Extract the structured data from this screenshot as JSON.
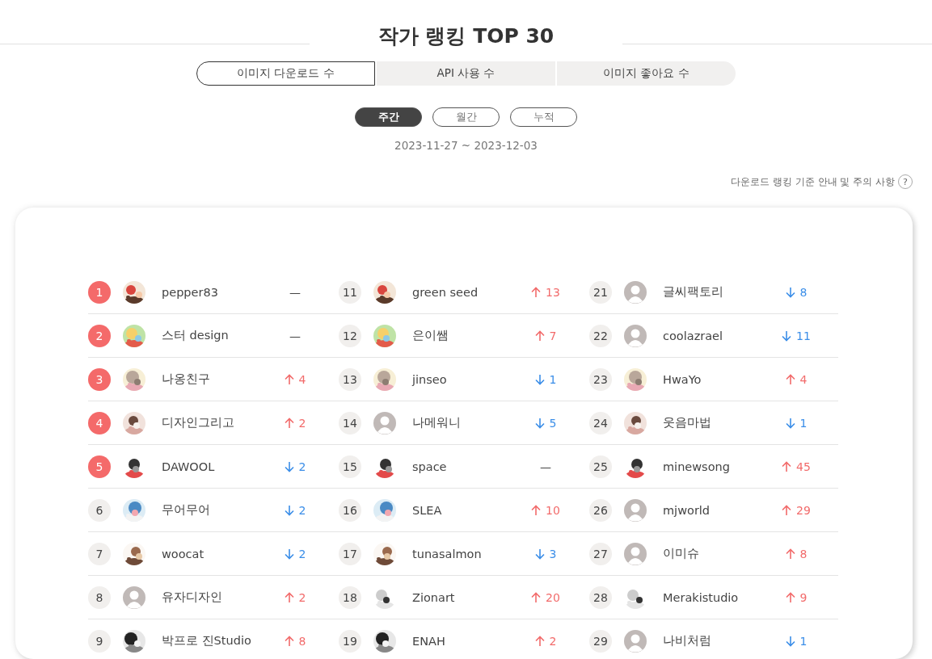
{
  "title": "작가 랭킹 TOP 30",
  "metric_tabs": [
    {
      "label": "이미지 다운로드 수",
      "selected": true
    },
    {
      "label": "API 사용 수",
      "selected": false
    },
    {
      "label": "이미지 좋아요 수",
      "selected": false
    }
  ],
  "period_tabs": [
    {
      "label": "주간",
      "selected": true
    },
    {
      "label": "월간",
      "selected": false
    },
    {
      "label": "누적",
      "selected": false
    }
  ],
  "date_range": "2023-11-27 ~ 2023-12-03",
  "help_link": {
    "label": "다운로드 랭킹 기준 안내 및 주의 사항",
    "icon": "?"
  },
  "columns": [
    {
      "entries": [
        {
          "rank": "1",
          "top": true,
          "name": "pepper83",
          "trend": {
            "kind": "same",
            "amount": "—"
          }
        },
        {
          "rank": "2",
          "top": true,
          "name": "스터 design",
          "trend": {
            "kind": "same",
            "amount": "—"
          }
        },
        {
          "rank": "3",
          "top": true,
          "name": "나옹친구",
          "trend": {
            "kind": "up",
            "amount": "4"
          }
        },
        {
          "rank": "4",
          "top": true,
          "name": "디자인그리고",
          "trend": {
            "kind": "up",
            "amount": "2"
          }
        },
        {
          "rank": "5",
          "top": true,
          "name": "DAWOOL",
          "trend": {
            "kind": "down",
            "amount": "2"
          }
        },
        {
          "rank": "6",
          "top": false,
          "name": "무어무어",
          "trend": {
            "kind": "down",
            "amount": "2"
          }
        },
        {
          "rank": "7",
          "top": false,
          "name": "woocat",
          "trend": {
            "kind": "down",
            "amount": "2"
          }
        },
        {
          "rank": "8",
          "top": false,
          "name": "유자디자인",
          "avatar": {
            "kind": "default"
          },
          "trend": {
            "kind": "up",
            "amount": "2"
          }
        },
        {
          "rank": "9",
          "top": false,
          "name": "박프로 진Studio",
          "trend": {
            "kind": "up",
            "amount": "8"
          }
        }
      ]
    },
    {
      "entries": [
        {
          "rank": "11",
          "top": false,
          "name": "green seed",
          "trend": {
            "kind": "up",
            "amount": "13"
          }
        },
        {
          "rank": "12",
          "top": false,
          "name": "은이쌤",
          "trend": {
            "kind": "up",
            "amount": "7"
          }
        },
        {
          "rank": "13",
          "top": false,
          "name": "jinseo",
          "trend": {
            "kind": "down",
            "amount": "1"
          }
        },
        {
          "rank": "14",
          "top": false,
          "name": "나메워니",
          "avatar": {
            "kind": "default"
          },
          "trend": {
            "kind": "down",
            "amount": "5"
          }
        },
        {
          "rank": "15",
          "top": false,
          "name": "space",
          "trend": {
            "kind": "same",
            "amount": "—"
          }
        },
        {
          "rank": "16",
          "top": false,
          "name": "SLEA",
          "trend": {
            "kind": "up",
            "amount": "10"
          }
        },
        {
          "rank": "17",
          "top": false,
          "name": "tunasalmon",
          "trend": {
            "kind": "down",
            "amount": "3"
          }
        },
        {
          "rank": "18",
          "top": false,
          "name": "Zionart",
          "trend": {
            "kind": "up",
            "amount": "20"
          }
        },
        {
          "rank": "19",
          "top": false,
          "name": "ENAH",
          "trend": {
            "kind": "up",
            "amount": "2"
          }
        }
      ]
    },
    {
      "entries": [
        {
          "rank": "21",
          "top": false,
          "name": "글씨팩토리",
          "avatar": {
            "kind": "default"
          },
          "trend": {
            "kind": "down",
            "amount": "8"
          }
        },
        {
          "rank": "22",
          "top": false,
          "name": "coolazrael",
          "avatar": {
            "kind": "default"
          },
          "trend": {
            "kind": "down",
            "amount": "11"
          }
        },
        {
          "rank": "23",
          "top": false,
          "name": "HwaYo",
          "trend": {
            "kind": "up",
            "amount": "4"
          }
        },
        {
          "rank": "24",
          "top": false,
          "name": "웃음마법",
          "trend": {
            "kind": "down",
            "amount": "1"
          }
        },
        {
          "rank": "25",
          "top": false,
          "name": "minewsong",
          "trend": {
            "kind": "up",
            "amount": "45"
          }
        },
        {
          "rank": "26",
          "top": false,
          "name": "mjworld",
          "avatar": {
            "kind": "default"
          },
          "trend": {
            "kind": "up",
            "amount": "29"
          }
        },
        {
          "rank": "27",
          "top": false,
          "name": "이미슈",
          "avatar": {
            "kind": "default"
          },
          "trend": {
            "kind": "up",
            "amount": "8"
          }
        },
        {
          "rank": "28",
          "top": false,
          "name": "Merakistudio",
          "trend": {
            "kind": "up",
            "amount": "9"
          }
        },
        {
          "rank": "29",
          "top": false,
          "name": "나비처럼",
          "avatar": {
            "kind": "default"
          },
          "trend": {
            "kind": "down",
            "amount": "1"
          }
        }
      ]
    }
  ]
}
